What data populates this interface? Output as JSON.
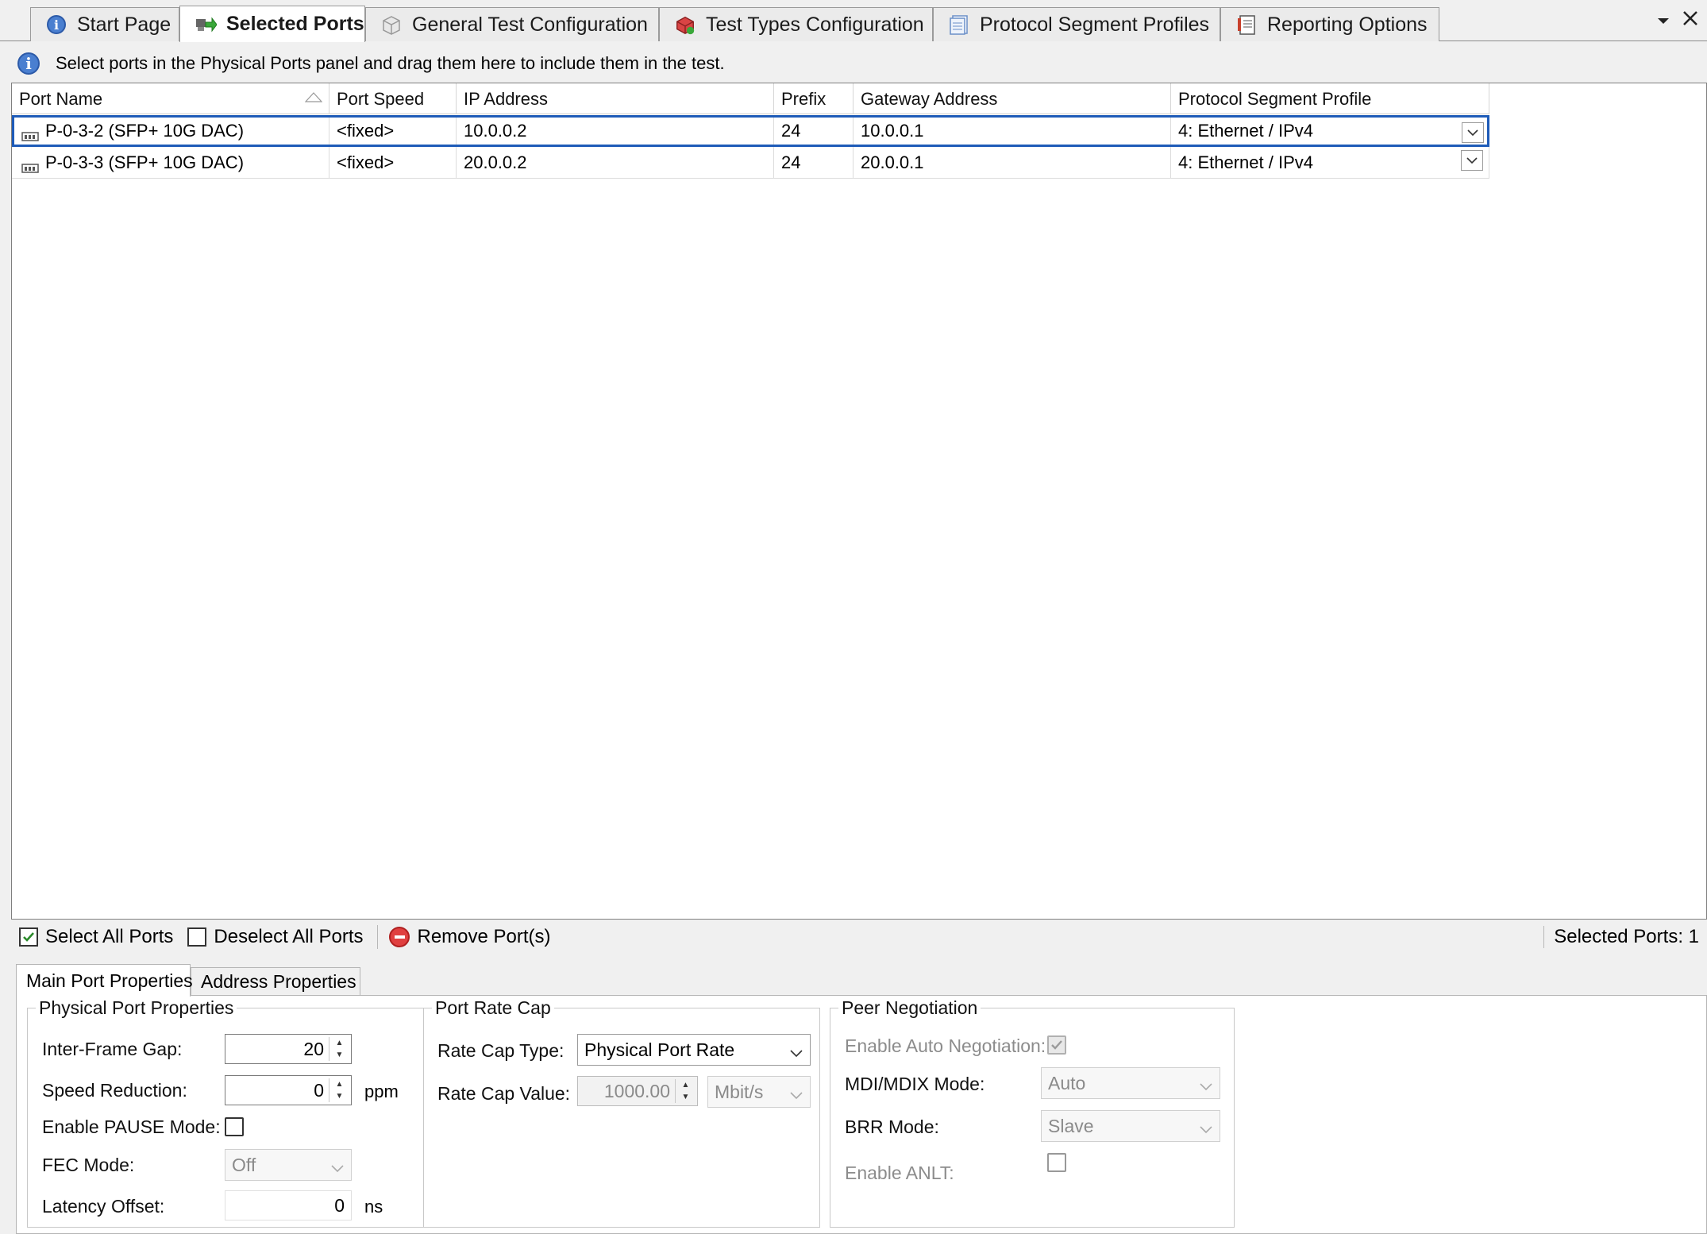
{
  "tabs": [
    {
      "label": "Start Page",
      "icon": "info-icon"
    },
    {
      "label": "Selected Ports",
      "icon": "ports-icon",
      "active": true
    },
    {
      "label": "General Test Configuration",
      "icon": "config-icon"
    },
    {
      "label": "Test Types Configuration",
      "icon": "test-types-icon"
    },
    {
      "label": "Protocol Segment Profiles",
      "icon": "profiles-icon"
    },
    {
      "label": "Reporting Options",
      "icon": "report-icon"
    }
  ],
  "info_text": "Select ports in the Physical Ports panel and drag them here to include them in the test.",
  "grid": {
    "columns": [
      "Port Name",
      "Port Speed",
      "IP Address",
      "Prefix",
      "Gateway Address",
      "Protocol Segment Profile"
    ],
    "rows": [
      {
        "port_name": "P-0-3-2 (SFP+ 10G DAC)",
        "port_speed": "<fixed>",
        "ip": "10.0.0.2",
        "prefix": "24",
        "gateway": "10.0.0.1",
        "profile": "4: Ethernet / IPv4",
        "selected": true
      },
      {
        "port_name": "P-0-3-3 (SFP+ 10G DAC)",
        "port_speed": "<fixed>",
        "ip": "20.0.0.2",
        "prefix": "24",
        "gateway": "20.0.0.1",
        "profile": "4: Ethernet / IPv4",
        "selected": false
      }
    ]
  },
  "toolbar": {
    "select_all": "Select All Ports",
    "deselect_all": "Deselect All Ports",
    "remove": "Remove Port(s)",
    "selected_count": "Selected Ports: 1"
  },
  "subtabs": [
    "Main Port Properties",
    "Address Properties"
  ],
  "physical": {
    "legend": "Physical Port Properties",
    "ifg_label": "Inter-Frame Gap:",
    "ifg_value": "20",
    "speed_label": "Speed Reduction:",
    "speed_value": "0",
    "speed_unit": "ppm",
    "pause_label": "Enable PAUSE Mode:",
    "fec_label": "FEC Mode:",
    "fec_value": "Off",
    "latency_label": "Latency Offset:",
    "latency_value": "0",
    "latency_unit": "ns"
  },
  "ratecap": {
    "legend": "Port Rate Cap",
    "type_label": "Rate Cap Type:",
    "type_value": "Physical Port Rate",
    "value_label": "Rate Cap Value:",
    "value": "1000.00",
    "unit": "Mbit/s"
  },
  "peer": {
    "legend": "Peer Negotiation",
    "auto_label": "Enable Auto Negotiation:",
    "mdi_label": "MDI/MDIX Mode:",
    "mdi_value": "Auto",
    "brr_label": "BRR Mode:",
    "brr_value": "Slave",
    "anlt_label": "Enable ANLT:"
  },
  "colors": {
    "accent": "#1e5bb8",
    "remove": "#e04040"
  }
}
